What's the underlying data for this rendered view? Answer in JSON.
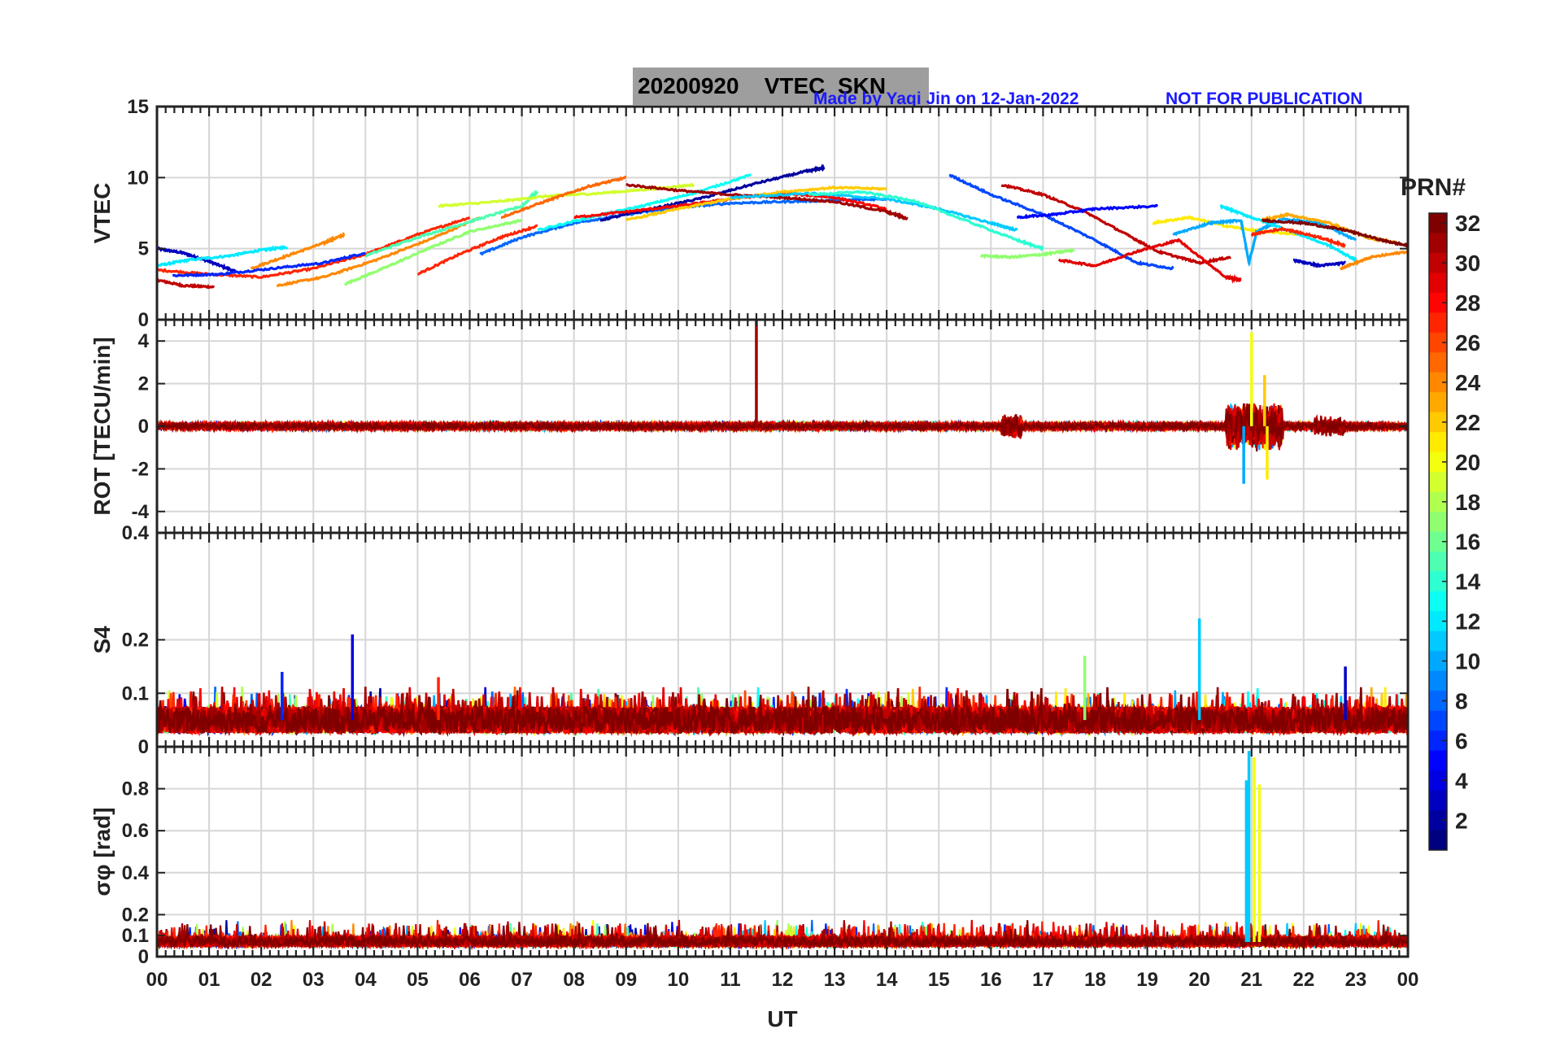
{
  "figure": {
    "title_date": "20200920",
    "title_label": "VTEC  SKN",
    "credit": "Made by Yaqi Jin on 12-Jan-2022",
    "notice": "NOT FOR PUBLICATION",
    "xlabel": "UT",
    "x_ticks": [
      "00",
      "01",
      "02",
      "03",
      "04",
      "05",
      "06",
      "07",
      "08",
      "09",
      "10",
      "11",
      "12",
      "13",
      "14",
      "15",
      "16",
      "17",
      "18",
      "19",
      "20",
      "21",
      "22",
      "23",
      "00"
    ],
    "colorbar": {
      "label": "PRN#",
      "colormap": "jet",
      "range": [
        1,
        32
      ],
      "ticks": [
        "32",
        "30",
        "28",
        "26",
        "24",
        "22",
        "20",
        "18",
        "16",
        "14",
        "12",
        "10",
        "8",
        "6",
        "4",
        "2"
      ]
    }
  },
  "chart_data": [
    {
      "type": "line",
      "panel": "VTEC",
      "ylabel": "VTEC",
      "xlim": [
        0,
        24
      ],
      "ylim": [
        0,
        15
      ],
      "y_ticks": [
        "15",
        "10",
        "5",
        "0"
      ],
      "grid": true,
      "series": [
        {
          "prn": 3,
          "x": [
            0.0,
            0.5,
            1.0,
            1.5
          ],
          "y": [
            5.0,
            4.7,
            4.1,
            3.4
          ]
        },
        {
          "prn": 30,
          "x": [
            0.0,
            0.5,
            1.1
          ],
          "y": [
            2.8,
            2.4,
            2.3
          ]
        },
        {
          "prn": 12,
          "x": [
            0.0,
            0.6,
            1.4,
            2.0,
            2.5
          ],
          "y": [
            3.8,
            4.2,
            4.5,
            4.9,
            5.1
          ]
        },
        {
          "prn": 24,
          "x": [
            1.8,
            2.5,
            3.2,
            3.6
          ],
          "y": [
            3.6,
            4.5,
            5.4,
            6.0
          ]
        },
        {
          "prn": 27,
          "x": [
            0.0,
            1.0,
            2.0,
            3.0,
            4.0,
            5.0,
            6.0
          ],
          "y": [
            3.5,
            3.2,
            3.0,
            3.6,
            4.6,
            6.0,
            7.2
          ]
        },
        {
          "prn": 6,
          "x": [
            0.3,
            1.2,
            2.2,
            3.2,
            4.0
          ],
          "y": [
            3.1,
            3.2,
            3.6,
            4.0,
            4.7
          ]
        },
        {
          "prn": 24,
          "x": [
            2.3,
            3.2,
            4.2,
            5.2,
            6.2
          ],
          "y": [
            2.4,
            3.0,
            4.2,
            5.6,
            7.2
          ]
        },
        {
          "prn": 17,
          "x": [
            3.6,
            4.4,
            5.2,
            6.0,
            7.0
          ],
          "y": [
            2.5,
            3.7,
            5.0,
            6.2,
            7.0
          ]
        },
        {
          "prn": 15,
          "x": [
            4.0,
            5.0,
            6.0,
            7.0,
            7.3
          ],
          "y": [
            4.5,
            5.8,
            6.9,
            8.0,
            9.0
          ]
        },
        {
          "prn": 19,
          "x": [
            5.4,
            6.5,
            7.5,
            8.5,
            9.5,
            10.3
          ],
          "y": [
            8.0,
            8.3,
            8.7,
            8.9,
            9.2,
            9.5
          ]
        },
        {
          "prn": 27,
          "x": [
            5.0,
            5.8,
            6.6,
            7.3
          ],
          "y": [
            3.2,
            4.6,
            5.8,
            6.6
          ]
        },
        {
          "prn": 8,
          "x": [
            6.2,
            7.0,
            8.0,
            9.0,
            10.0,
            11.0,
            12.0,
            13.0,
            14.0
          ],
          "y": [
            4.6,
            5.8,
            6.8,
            7.4,
            7.9,
            8.2,
            8.3,
            8.4,
            8.5
          ]
        },
        {
          "prn": 25,
          "x": [
            6.6,
            7.5,
            8.3,
            9.0
          ],
          "y": [
            7.2,
            8.4,
            9.4,
            10.0
          ]
        },
        {
          "prn": 13,
          "x": [
            7.3,
            8.3,
            9.3,
            10.3,
            11.4
          ],
          "y": [
            6.3,
            7.2,
            8.0,
            8.9,
            10.2
          ]
        },
        {
          "prn": 2,
          "x": [
            8.5,
            9.5,
            10.5,
            11.5,
            12.4,
            12.8
          ],
          "y": [
            7.0,
            7.8,
            8.6,
            9.6,
            10.4,
            10.7
          ]
        },
        {
          "prn": 28,
          "x": [
            8.0,
            9.0,
            10.0,
            11.0,
            12.0,
            13.0,
            14.0
          ],
          "y": [
            7.2,
            7.6,
            8.0,
            8.5,
            8.9,
            8.6,
            7.8
          ]
        },
        {
          "prn": 22,
          "x": [
            9.0,
            10.0,
            11.0,
            12.0,
            13.0,
            14.0
          ],
          "y": [
            7.0,
            7.8,
            8.5,
            9.0,
            9.3,
            9.2
          ]
        },
        {
          "prn": 31,
          "x": [
            9.0,
            10.0,
            11.0,
            12.0,
            13.0,
            14.0,
            14.4
          ],
          "y": [
            9.5,
            9.1,
            8.8,
            8.6,
            8.3,
            7.6,
            7.1
          ]
        },
        {
          "prn": 11,
          "x": [
            11.0,
            12.5,
            14.0,
            15.0,
            16.0,
            16.5
          ],
          "y": [
            8.6,
            8.9,
            8.5,
            7.8,
            6.8,
            6.3
          ]
        },
        {
          "prn": 14,
          "x": [
            12.5,
            13.5,
            14.5,
            15.5,
            16.5,
            17.0
          ],
          "y": [
            8.8,
            9.0,
            8.4,
            7.0,
            5.6,
            5.0
          ]
        },
        {
          "prn": 17,
          "x": [
            15.8,
            16.4,
            17.0,
            17.6
          ],
          "y": [
            4.5,
            4.4,
            4.6,
            4.9
          ]
        },
        {
          "prn": 7,
          "x": [
            15.2,
            16.0,
            17.0,
            18.0,
            18.8,
            19.5
          ],
          "y": [
            10.2,
            8.8,
            7.4,
            5.6,
            4.0,
            3.6
          ]
        },
        {
          "prn": 30,
          "x": [
            16.2,
            17.0,
            17.8,
            18.6,
            19.2,
            20.0,
            20.6
          ],
          "y": [
            9.5,
            8.8,
            7.6,
            6.0,
            4.8,
            4.0,
            4.4
          ]
        },
        {
          "prn": 5,
          "x": [
            16.5,
            17.2,
            18.0,
            19.2
          ],
          "y": [
            7.2,
            7.4,
            7.8,
            8.0
          ]
        },
        {
          "prn": 29,
          "x": [
            17.3,
            18.0,
            18.8,
            19.6,
            20.5,
            20.8
          ],
          "y": [
            4.2,
            3.8,
            4.8,
            5.6,
            3.0,
            2.8
          ]
        },
        {
          "prn": 21,
          "x": [
            19.1,
            19.8,
            20.5,
            21.2,
            22.0
          ],
          "y": [
            6.8,
            7.2,
            6.6,
            6.2,
            6.0
          ]
        },
        {
          "prn": 10,
          "x": [
            19.5,
            20.2,
            20.8,
            20.95,
            21.1,
            21.6,
            22.3,
            23.0
          ],
          "y": [
            6.0,
            6.8,
            7.0,
            4.0,
            6.2,
            7.1,
            6.8,
            5.6
          ]
        },
        {
          "prn": 12,
          "x": [
            20.4,
            21.0,
            21.7,
            22.5,
            23.0
          ],
          "y": [
            8.0,
            7.2,
            6.3,
            5.2,
            4.2
          ]
        },
        {
          "prn": 23,
          "x": [
            21.2,
            21.7,
            22.5,
            23.2,
            23.8
          ],
          "y": [
            7.0,
            7.4,
            6.8,
            5.8,
            5.4
          ]
        },
        {
          "prn": 3,
          "x": [
            21.8,
            22.3,
            22.8
          ],
          "y": [
            4.2,
            3.8,
            4.0
          ]
        },
        {
          "prn": 32,
          "x": [
            21.2,
            22.0,
            22.8,
            23.5,
            24.0
          ],
          "y": [
            7.0,
            6.8,
            6.3,
            5.6,
            5.2
          ]
        },
        {
          "prn": 27,
          "x": [
            21.0,
            21.6,
            22.3,
            22.8
          ],
          "y": [
            6.0,
            6.4,
            5.8,
            5.2
          ]
        },
        {
          "prn": 24,
          "x": [
            22.7,
            23.3,
            24.0
          ],
          "y": [
            3.6,
            4.4,
            4.8
          ]
        }
      ]
    },
    {
      "type": "line",
      "panel": "ROT",
      "ylabel": "ROT [TECU/min]",
      "xlim": [
        0,
        24
      ],
      "ylim": [
        -5,
        5
      ],
      "y_ticks": [
        "4",
        "2",
        "0",
        "-2",
        "-4"
      ],
      "grid": true,
      "noise_band": 0.2,
      "spikes": [
        {
          "prn": 31,
          "x": 11.5,
          "y": 5.0
        },
        {
          "prn": 20,
          "x": 21.0,
          "y": 4.4
        },
        {
          "prn": 10,
          "x": 20.85,
          "y": -2.7
        },
        {
          "prn": 21,
          "x": 21.3,
          "y": -2.5
        },
        {
          "prn": 22,
          "x": 21.25,
          "y": 2.4
        }
      ]
    },
    {
      "type": "line",
      "panel": "S4",
      "ylabel": "S4",
      "xlim": [
        0,
        24
      ],
      "ylim": [
        0,
        0.4
      ],
      "y_ticks": [
        "0.4",
        "0.2",
        "0.1",
        "0"
      ],
      "grid": true,
      "baseline": 0.05,
      "spikes": [
        {
          "prn": 4,
          "x": 3.75,
          "y": 0.21
        },
        {
          "prn": 11,
          "x": 20.0,
          "y": 0.24
        },
        {
          "prn": 17,
          "x": 17.8,
          "y": 0.17
        },
        {
          "prn": 6,
          "x": 2.4,
          "y": 0.14
        },
        {
          "prn": 3,
          "x": 22.8,
          "y": 0.15
        },
        {
          "prn": 27,
          "x": 5.4,
          "y": 0.13
        }
      ]
    },
    {
      "type": "line",
      "panel": "SigmaPhi",
      "ylabel": "σφ [rad]",
      "xlim": [
        0,
        24
      ],
      "ylim": [
        0,
        1
      ],
      "y_ticks": [
        "0.8",
        "0.6",
        "0.4",
        "0.2",
        "0.1",
        "0"
      ],
      "grid": true,
      "baseline": 0.07,
      "spikes": [
        {
          "prn": 11,
          "x": 20.95,
          "y": 0.98
        },
        {
          "prn": 20,
          "x": 21.05,
          "y": 0.95
        },
        {
          "prn": 11,
          "x": 20.9,
          "y": 0.84
        },
        {
          "prn": 20,
          "x": 21.15,
          "y": 0.82
        }
      ]
    }
  ]
}
